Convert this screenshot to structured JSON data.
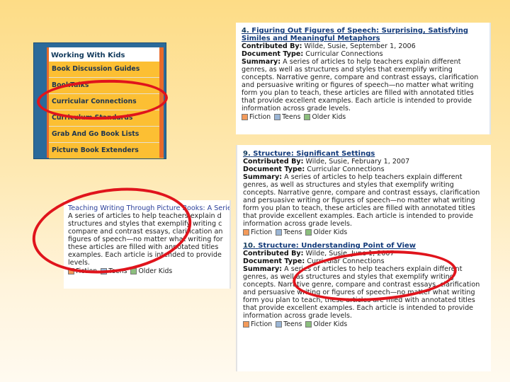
{
  "menu": {
    "title": "Working With Kids",
    "items": [
      "Book Discussion Guides",
      "BookTalks",
      "Curricular Connections",
      "Curriculum Standards",
      "Grab And Go Book Lists",
      "Picture Book Extenders"
    ]
  },
  "labels": {
    "contributed_by": "Contributed By:",
    "document_type": "Document Type:",
    "summary": "Summary:"
  },
  "tags": [
    "Fiction",
    "Teens",
    "Older Kids"
  ],
  "card4": {
    "number": "4.",
    "title": "Figuring Out Figures of Speech: Surprising, Satisfying Similes and Meaningful Metaphors",
    "contributor": "Wilde, Susie, September 1, 2006",
    "doc_type": "Curricular Connections",
    "summary": "A series of articles to help teachers explain different genres, as well as structures and styles that exemplify writing concepts. Narrative genre, compare and contrast essays, clarification and persuasive writing or figures of speech—no matter what writing form you plan to teach, these articles are filled with annotated titles that provide excellent examples. Each article is intended to provide information across grade levels."
  },
  "card9": {
    "number": "9.",
    "title": "Structure: Significant Settings",
    "contributor": "Wilde, Susie, February 1, 2007",
    "doc_type": "Curricular Connections",
    "summary": "A series of articles to help teachers explain different genres, as well as structures and styles that exemplify writing concepts. Narrative genre, compare and contrast essays, clarification and persuasive writing or figures of speech—no matter what writing form you plan to teach, these articles are filled with annotated titles that provide excellent examples. Each article is intended to provide information across grade levels."
  },
  "card10": {
    "number": "10.",
    "title": "Structure: Understanding Point of View",
    "contributor": "Wilde, Susie, June 1, 2007",
    "doc_type": "Curricular Connections",
    "summary": "A series of articles to help teachers explain different genres, as well as structures and styles that exemplify writing concepts. Narrative genre, compare and contrast essays, clarification and persuasive writing or figures of speech—no matter what writing form you plan to teach, these articles are filled with annotated titles that provide excellent examples. Each article is intended to provide information across grade levels."
  },
  "card_left": {
    "title": "Teaching Writing Through Picture Books: A Serie",
    "lines": [
      "A series of articles to help teachers explain d",
      "structures and styles that exemplify writing c",
      "compare and contrast essays, clarification an",
      "figures of speech—no matter what writing for",
      "these articles are filled with annotated titles",
      "examples. Each article is intended to provide",
      "levels."
    ]
  },
  "colors": {
    "menu_item": "#fcbf33",
    "menu_frame": "#2b6a9a",
    "highlight": "#e0141c",
    "tag_fiction": "#f39a5a",
    "tag_teens": "#9bb6d6",
    "tag_older_kids": "#8cbf7e"
  }
}
